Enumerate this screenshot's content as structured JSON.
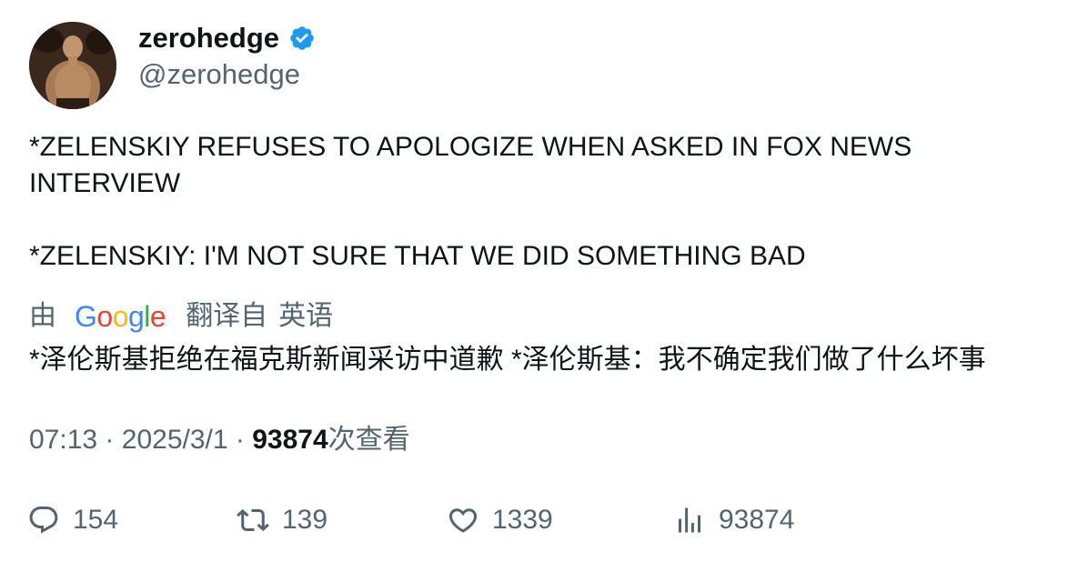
{
  "author": {
    "display_name": "zerohedge",
    "handle": "@zerohedge",
    "verified_icon": "verified-badge-icon",
    "verified_color": "#1d9bf0"
  },
  "tweet": {
    "line1": "*ZELENSKIY REFUSES TO APOLOGIZE WHEN ASKED IN FOX NEWS INTERVIEW",
    "line2": "*ZELENSKIY: I'M NOT SURE THAT WE DID SOMETHING BAD"
  },
  "translation": {
    "by_label": "由",
    "provider": "Google",
    "translated_from": "翻译自",
    "language": "英语",
    "text": "*泽伦斯基拒绝在福克斯新闻采访中道歉 *泽伦斯基：我不确定我们做了什么坏事"
  },
  "meta": {
    "time": "07:13",
    "separator": "·",
    "date": "2025/3/1",
    "views_count": "93874",
    "views_label": "次查看"
  },
  "actions": {
    "replies": {
      "icon": "reply-icon",
      "count": "154"
    },
    "retweets": {
      "icon": "retweet-icon",
      "count": "139"
    },
    "likes": {
      "icon": "heart-icon",
      "count": "1339"
    },
    "views": {
      "icon": "analytics-icon",
      "count": "93874"
    }
  },
  "colors": {
    "text_primary": "#0f1419",
    "text_secondary": "#536471",
    "accent": "#1d9bf0"
  }
}
